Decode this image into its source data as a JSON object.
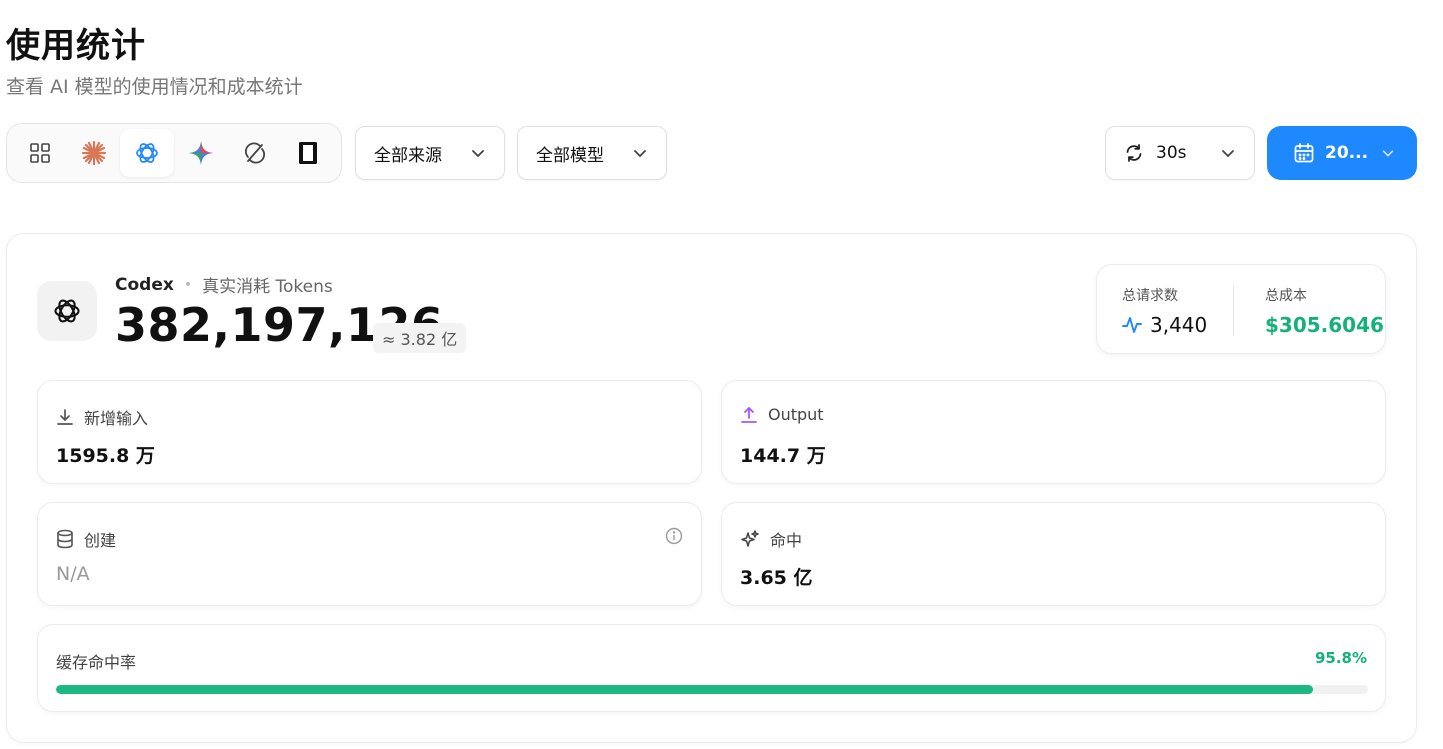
{
  "header": {
    "title": "使用统计",
    "subtitle": "查看 AI 模型的使用情况和成本统计"
  },
  "toolbar": {
    "providers": [
      {
        "name": "grid-icon",
        "active": false
      },
      {
        "name": "claude-icon",
        "active": false
      },
      {
        "name": "openai-icon",
        "active": true
      },
      {
        "name": "gemini-icon",
        "active": false
      },
      {
        "name": "cycle-icon",
        "active": false
      },
      {
        "name": "device-icon",
        "active": false
      }
    ],
    "source_select": "全部来源",
    "model_select": "全部模型",
    "refresh_interval": "30s",
    "date_range": "20..."
  },
  "summary": {
    "provider_name": "Codex",
    "description": "真实消耗 Tokens",
    "total_tokens": "382,197,126",
    "approx": "≈ 3.82 亿",
    "requests_label": "总请求数",
    "requests_value": "3,440",
    "cost_label": "总成本",
    "cost_value": "$305.6046"
  },
  "metrics": {
    "input_label": "新增输入",
    "input_value": "1595.8 万",
    "output_label": "Output",
    "output_value": "144.7 万",
    "create_label": "创建",
    "create_value": "N/A",
    "hit_label": "命中",
    "hit_value": "3.65 亿"
  },
  "cache": {
    "label": "缓存命中率",
    "rate_text": "95.8%",
    "rate_fraction": 0.958
  },
  "colors": {
    "accent": "#1e88ff",
    "success": "#16b07a",
    "progress": "#1db882",
    "claude": "#d97757",
    "output_icon": "#a855f7"
  }
}
